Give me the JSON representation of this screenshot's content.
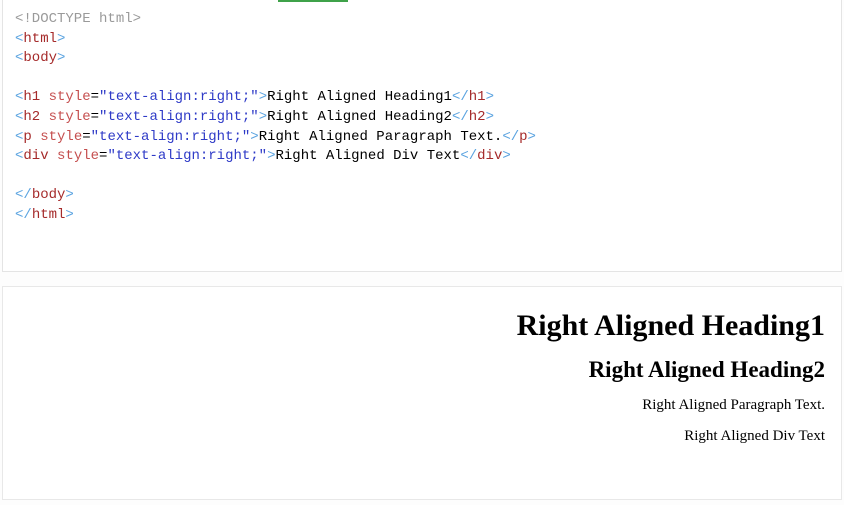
{
  "code": {
    "doctype": "<!DOCTYPE html>",
    "html_open_a": "<",
    "html_open_t": "html",
    "html_open_b": ">",
    "body_open_a": "<",
    "body_open_t": "body",
    "body_open_b": ">",
    "h1": {
      "oa": "<",
      "tag": "h1",
      "sp": " ",
      "attr": "style",
      "eq": "=",
      "val": "\"text-align:right;\"",
      "ob": ">",
      "txt": "Right Aligned Heading1",
      "ca": "</",
      "cb": ">"
    },
    "h2": {
      "oa": "<",
      "tag": "h2",
      "sp": " ",
      "attr": "style",
      "eq": "=",
      "val": "\"text-align:right;\"",
      "ob": ">",
      "txt": "Right Aligned Heading2",
      "ca": "</",
      "cb": ">"
    },
    "p": {
      "oa": "<",
      "tag": "p",
      "sp": " ",
      "attr": "style",
      "eq": "=",
      "val": "\"text-align:right;\"",
      "ob": ">",
      "txt": "Right Aligned Paragraph Text.",
      "ca": "</",
      "cb": ">"
    },
    "div": {
      "oa": "<",
      "tag": "div",
      "sp": " ",
      "attr": "style",
      "eq": "=",
      "val": "\"text-align:right;\"",
      "ob": ">",
      "txt": "Right Aligned Div Text",
      "ca": "</",
      "cb": ">"
    },
    "body_close_a": "</",
    "body_close_t": "body",
    "body_close_b": ">",
    "html_close_a": "</",
    "html_close_t": "html",
    "html_close_b": ">"
  },
  "output": {
    "h1": "Right Aligned Heading1",
    "h2": "Right Aligned Heading2",
    "p": "Right Aligned Paragraph Text.",
    "div": "Right Aligned Div Text"
  }
}
